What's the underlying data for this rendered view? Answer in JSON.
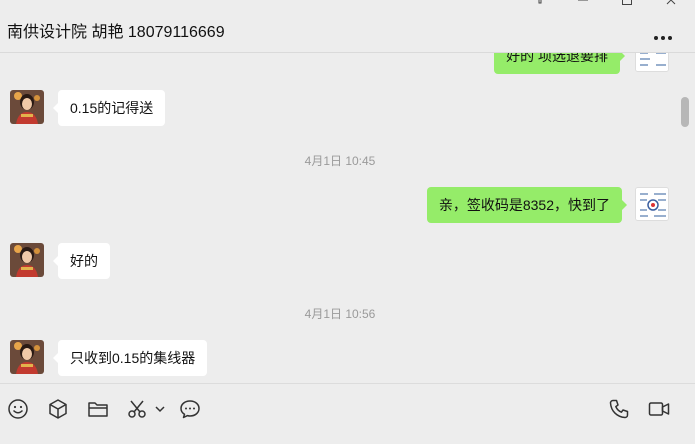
{
  "window": {
    "title": "南供设计院 胡艳 18079116669",
    "controls": {
      "pin_icon": "pin-icon",
      "minimize_icon": "minimize-icon",
      "maximize_icon": "maximize-icon",
      "close_icon": "close-icon"
    },
    "more_icon": "more-icon"
  },
  "messages": [
    {
      "side": "out",
      "text": "好的 项选退要排",
      "partial": true
    },
    {
      "side": "in",
      "text": "0.15的记得送"
    },
    {
      "type": "time",
      "text": "4月1日 10:45"
    },
    {
      "side": "out",
      "text": "亲，签收码是8352，快到了"
    },
    {
      "side": "in",
      "text": "好的"
    },
    {
      "type": "time",
      "text": "4月1日 10:56"
    },
    {
      "side": "in",
      "text": "只收到0.15的集线器"
    }
  ],
  "toolbar": {
    "left": [
      "emoji-icon",
      "cube-icon",
      "folder-icon",
      "scissors-icon",
      "chat-bubble-icon"
    ],
    "right": [
      "phone-icon",
      "video-icon"
    ]
  },
  "colors": {
    "background": "#ededed",
    "outgoing_bubble": "#95ec69",
    "incoming_bubble": "#ffffff",
    "timestamp": "#9a9a9a"
  }
}
